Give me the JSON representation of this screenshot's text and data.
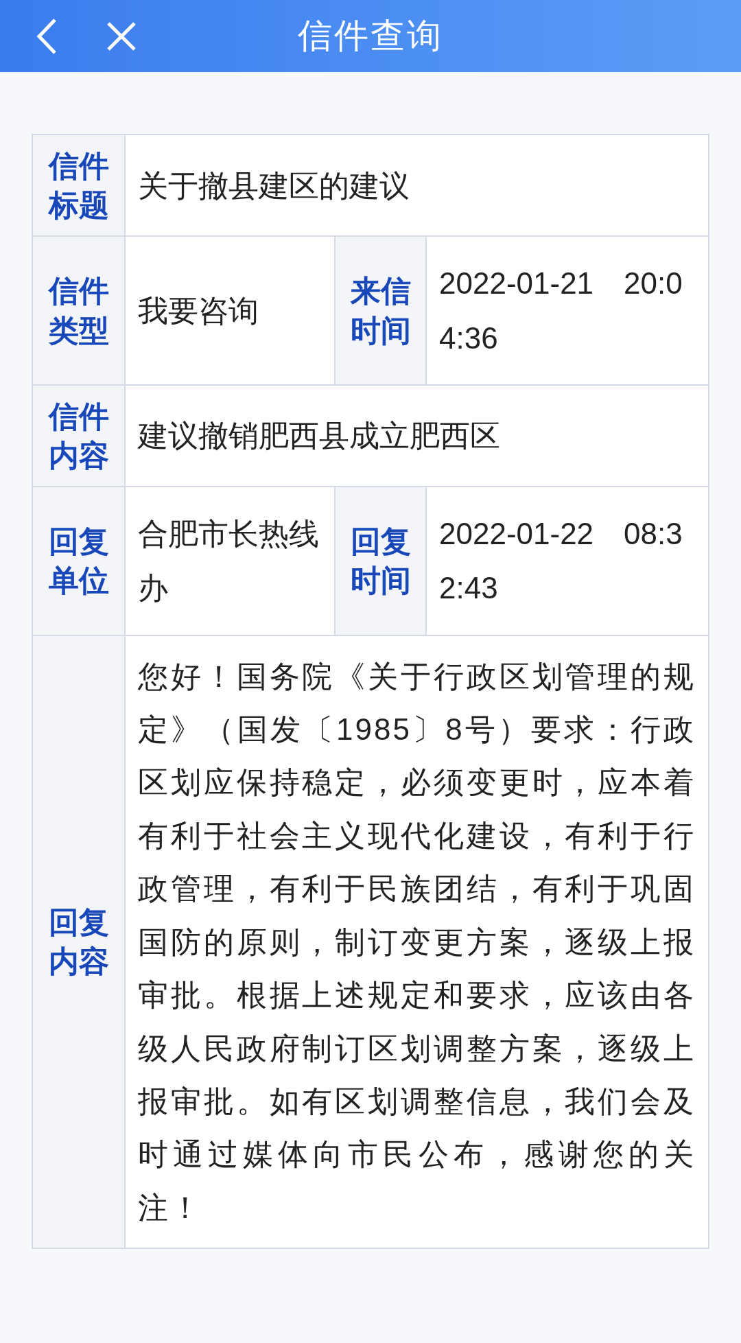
{
  "header": {
    "title": "信件查询"
  },
  "rows": [
    {
      "cells": [
        {
          "label": "信件标题",
          "value": "关于撤县建区的建议"
        }
      ]
    },
    {
      "cells": [
        {
          "label": "信件类型",
          "value": "我要咨询"
        },
        {
          "label": "来信时间",
          "value": "2022-01-21　20:04:36"
        }
      ]
    },
    {
      "cells": [
        {
          "label": "信件内容",
          "value": "建议撤销肥西县成立肥西区"
        }
      ]
    },
    {
      "cells": [
        {
          "label": "回复单位",
          "value": "合肥市长热线办"
        },
        {
          "label": "回复时间",
          "value": "2022-01-22　08:32:43"
        }
      ]
    },
    {
      "cells": [
        {
          "label": "回复内容",
          "value": "您好！国务院《关于行政区划管理的规定》（国发〔1985〕8号）要求：行政区划应保持稳定，必须变更时，应本着有利于社会主义现代化建设，有利于行政管理，有利于民族团结，有利于巩固国防的原则，制订变更方案，逐级上报审批。根据上述规定和要求，应该由各级人民政府制订区划调整方案，逐级上报审批。如有区划调整信息，我们会及时通过媒体向市民公布，感谢您的关注！"
        }
      ]
    }
  ]
}
